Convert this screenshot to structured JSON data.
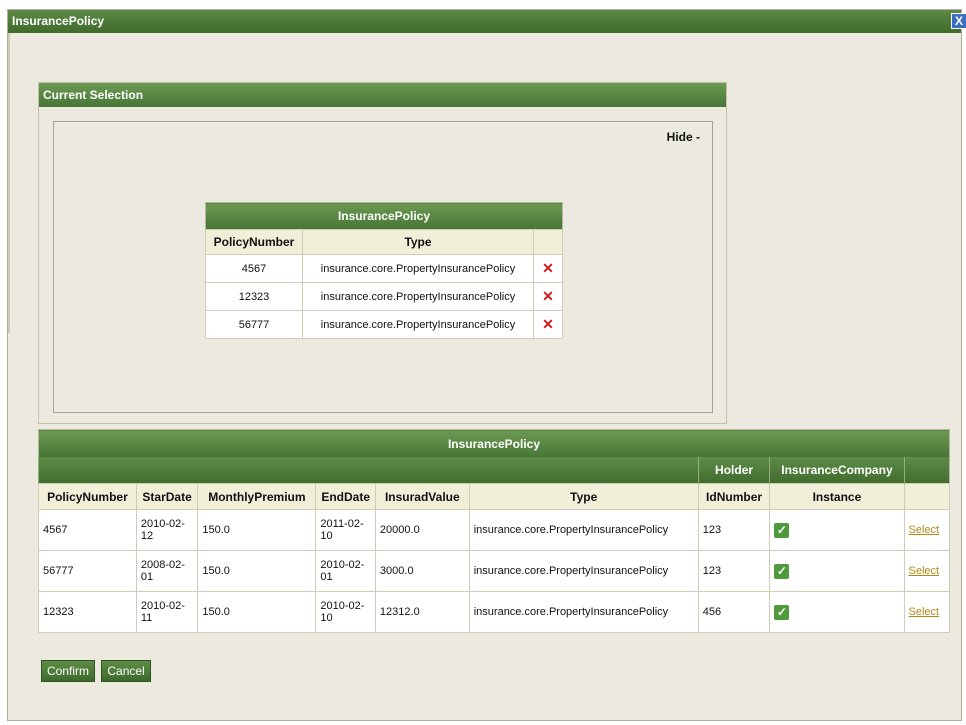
{
  "window": {
    "title": "InsurancePolicy",
    "close_label": "X"
  },
  "current_selection": {
    "title": "Current Selection",
    "hide_label": "Hide -",
    "table_caption": "InsurancePolicy",
    "columns": [
      "PolicyNumber",
      "Type"
    ],
    "rows": [
      {
        "policy_number": "4567",
        "type": "insurance.core.PropertyInsurancePolicy"
      },
      {
        "policy_number": "12323",
        "type": "insurance.core.PropertyInsurancePolicy"
      },
      {
        "policy_number": "56777",
        "type": "insurance.core.PropertyInsurancePolicy"
      }
    ],
    "remove_icon": "✕"
  },
  "results": {
    "caption": "InsurancePolicy",
    "group_headers": {
      "holder": "Holder",
      "company": "InsuranceCompany"
    },
    "columns": [
      "PolicyNumber",
      "StarDate",
      "MonthlyPremium",
      "EndDate",
      "InsuradValue",
      "Type",
      "IdNumber",
      "Instance"
    ],
    "rows": [
      {
        "policy_number": "4567",
        "star_date": "2010-02-12",
        "premium": "150.0",
        "end_date": "2011-02-10",
        "value": "20000.0",
        "type": "insurance.core.PropertyInsurancePolicy",
        "id_number": "123",
        "select": "Select"
      },
      {
        "policy_number": "56777",
        "star_date": "2008-02-01",
        "premium": "150.0",
        "end_date": "2010-02-01",
        "value": "3000.0",
        "type": "insurance.core.PropertyInsurancePolicy",
        "id_number": "123",
        "select": "Select"
      },
      {
        "policy_number": "12323",
        "star_date": "2010-02-11",
        "premium": "150.0",
        "end_date": "2010-02-10",
        "value": "12312.0",
        "type": "insurance.core.PropertyInsurancePolicy",
        "id_number": "456",
        "select": "Select"
      }
    ],
    "check_icon": "✓"
  },
  "buttons": {
    "confirm": "Confirm",
    "cancel": "Cancel"
  },
  "colors": {
    "header_green": "#467535",
    "select_link": "#b08a18",
    "remove_red": "#cc1b1b"
  }
}
